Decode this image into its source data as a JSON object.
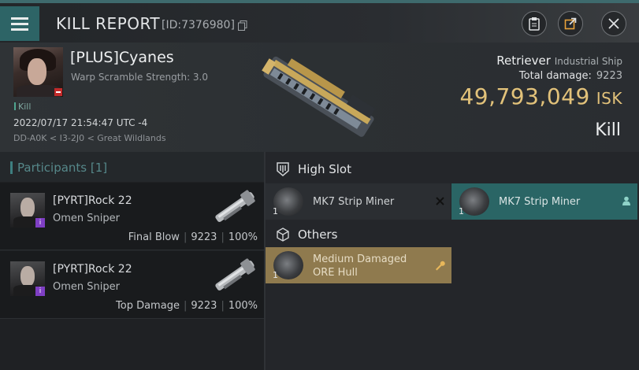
{
  "header": {
    "title": "KILL REPORT",
    "report_id": "[ID:7376980]",
    "menu_icon": "hamburger-menu-icon",
    "buttons": [
      "clipboard-icon",
      "external-link-icon",
      "close-icon"
    ]
  },
  "victim": {
    "name": "[PLUS]Cyanes",
    "scramble": "Warp Scramble Strength: 3.0",
    "kill_label": "Kill",
    "datetime": "2022/07/17 21:54:47 UTC -4",
    "location": "DD-A0K < I3-2J0 < Great Wildlands",
    "ship_name": "Retriever",
    "ship_class": "Industrial Ship",
    "total_damage_label": "Total damage:",
    "total_damage": "9223",
    "isk_value": "49,793,049",
    "isk_unit": "ISK",
    "result": "Kill"
  },
  "participants": {
    "label": "Participants [1]",
    "attackers": [
      {
        "name": "[PYRT]Rock 22",
        "ship": "Omen Sniper",
        "role": "Final Blow",
        "damage": "9223",
        "percent": "100%",
        "badge": "i"
      },
      {
        "name": "[PYRT]Rock 22",
        "ship": "Omen Sniper",
        "role": "Top Damage",
        "damage": "9223",
        "percent": "100%",
        "badge": "i"
      }
    ]
  },
  "modules": {
    "high_slot_label": "High Slot",
    "others_label": "Others",
    "high_slot": [
      {
        "qty": "1",
        "name": "MK7 Strip Miner",
        "status": "destroyed"
      },
      {
        "qty": "1",
        "name": "MK7 Strip Miner",
        "status": "dropped"
      }
    ],
    "others": [
      {
        "qty": "1",
        "name_line1": "Medium Damaged",
        "name_line2": "ORE Hull",
        "status": "salvage"
      }
    ]
  },
  "colors": {
    "accent_teal": "#2d6466",
    "isk_gold": "#e2c27a",
    "dropped_bg": "#2a6565",
    "others_bg": "#8f7a4e"
  }
}
